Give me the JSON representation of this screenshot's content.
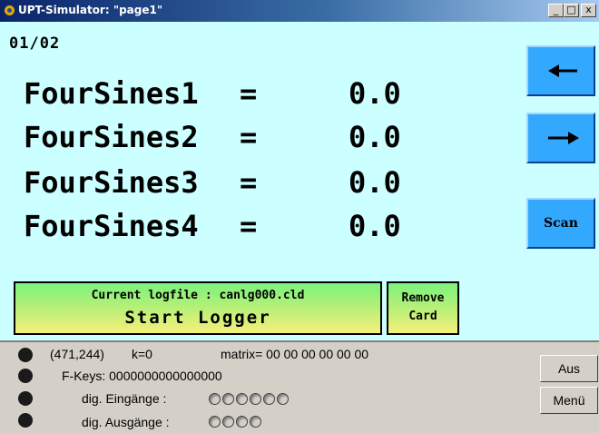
{
  "window": {
    "title": "UPT-Simulator: \"page1\"",
    "minimize": "_",
    "maximize": "□",
    "close": "x"
  },
  "display": {
    "page_number": "01/02",
    "rows": [
      {
        "label": "FourSines1",
        "eq": "=",
        "value": "0.0"
      },
      {
        "label": "FourSines2",
        "eq": "=",
        "value": "0.0"
      },
      {
        "label": "FourSines3",
        "eq": "=",
        "value": "0.0"
      },
      {
        "label": "FourSines4",
        "eq": "=",
        "value": "0.0"
      }
    ],
    "buttons": {
      "prev_icon": "arrow-left",
      "next_icon": "arrow-right",
      "scan_label": "Scan"
    },
    "logger": {
      "line1": "Current logfile : canlg000.cld",
      "line2": "Start Logger"
    },
    "remove_card": {
      "line1": "Remove",
      "line2": "Card"
    }
  },
  "status": {
    "coords": "(471,244)",
    "k": "k=0",
    "matrix": "matrix= 00 00 00 00 00 00",
    "fkeys": "F-Keys: 0000000000000000",
    "digital_inputs_label": "dig. Eingänge :",
    "digital_outputs_label": "dig. Ausgänge :",
    "aus_button": "Aus",
    "menu_button": "Menü"
  },
  "colors": {
    "display_bg": "#ccffff",
    "button_blue": "#33a8ff",
    "title_bar": "#0a246a"
  }
}
